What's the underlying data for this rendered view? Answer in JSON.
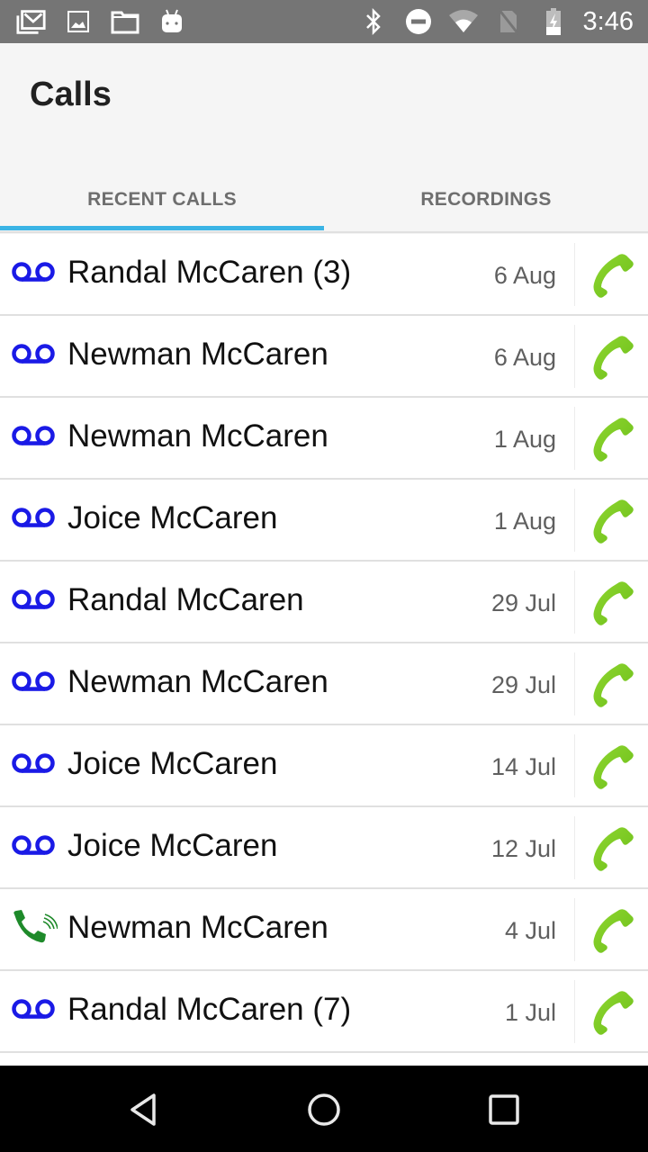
{
  "status_bar": {
    "time": "3:46",
    "left_icons": [
      "gmail-icon",
      "image-icon",
      "folder-icon",
      "android-icon"
    ],
    "right_icons": [
      "bluetooth-icon",
      "do-not-disturb-icon",
      "wifi-icon",
      "no-sim-icon",
      "battery-charging-icon"
    ]
  },
  "app_bar": {
    "title": "Calls"
  },
  "tabs": [
    {
      "label": "RECENT CALLS",
      "selected": true
    },
    {
      "label": "RECORDINGS",
      "selected": false
    }
  ],
  "colors": {
    "accent": "#3bb4e5",
    "voicemail_icon": "#1a1ae6",
    "call_icon": "#6cbf1a",
    "incoming_icon": "#1e8a2a"
  },
  "calls": [
    {
      "type": "voicemail",
      "name": "Randal McCaren (3)",
      "date": "6 Aug"
    },
    {
      "type": "voicemail",
      "name": "Newman McCaren",
      "date": "6 Aug"
    },
    {
      "type": "voicemail",
      "name": "Newman McCaren",
      "date": "1 Aug"
    },
    {
      "type": "voicemail",
      "name": "Joice McCaren",
      "date": "1 Aug"
    },
    {
      "type": "voicemail",
      "name": "Randal McCaren",
      "date": "29 Jul"
    },
    {
      "type": "voicemail",
      "name": "Newman McCaren",
      "date": "29 Jul"
    },
    {
      "type": "voicemail",
      "name": "Joice McCaren",
      "date": "14 Jul"
    },
    {
      "type": "voicemail",
      "name": "Joice McCaren",
      "date": "12 Jul"
    },
    {
      "type": "incoming",
      "name": "Newman McCaren",
      "date": "4 Jul"
    },
    {
      "type": "voicemail",
      "name": "Randal McCaren (7)",
      "date": "1 Jul"
    }
  ],
  "nav_bar": {
    "buttons": [
      "back",
      "home",
      "recents"
    ]
  }
}
